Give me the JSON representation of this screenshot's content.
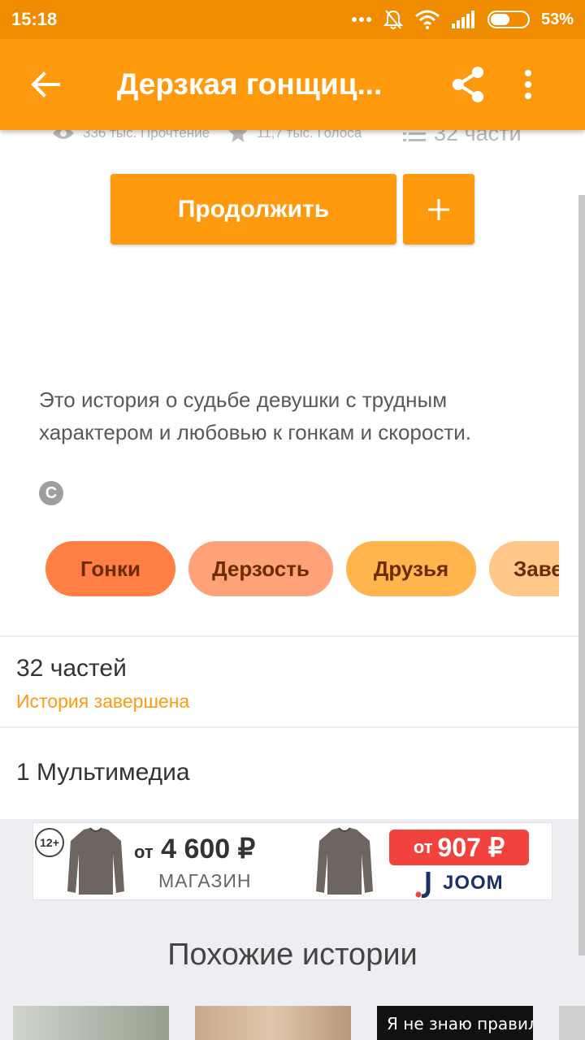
{
  "status_bar": {
    "time": "15:18",
    "battery_percent": "53%",
    "battery_level": 0.53,
    "icons": [
      "more-dots-icon",
      "mute-icon",
      "wifi-icon",
      "signal-icon",
      "battery-icon"
    ]
  },
  "app_bar": {
    "title": "Дерзкая гонщиц...",
    "back_icon": "arrow-back-icon",
    "share_icon": "share-icon",
    "more_icon": "more-vert-icon"
  },
  "stats": {
    "reads": "336 тыс. Прочтение",
    "votes": "11,7 тыс. Голоса",
    "parts": "32 части"
  },
  "actions": {
    "continue_label": "Продолжить",
    "add_label": "+"
  },
  "description": "Это история о судьбе девушки с трудным характером и любовью к гонкам и скорости.",
  "copyright_symbol": "C",
  "tags": [
    "Гонки",
    "Дерзость",
    "Друзья",
    "Заве"
  ],
  "parts_section": {
    "count": "32 частей",
    "status": "История завершена"
  },
  "multimedia": "1 Мультимедиа",
  "ad": {
    "age_rating": "12+",
    "price_prefix": "от",
    "price_1": "4 600 ₽",
    "shop": "МАГАЗИН",
    "price_2_prefix": "от",
    "price_2": "907 ₽",
    "brand": "JOOM"
  },
  "similar": {
    "title": "Похожие истории",
    "thumbnails": [
      "",
      "",
      "Я не знаю правил!",
      ""
    ]
  },
  "colors": {
    "primary": "#ff9a0e",
    "status_bar": "#f08c00",
    "tag_1": "#ff7f45",
    "tag_2": "#ffa27a",
    "tag_3": "#ffb44d",
    "tag_4": "#ffc78a"
  }
}
